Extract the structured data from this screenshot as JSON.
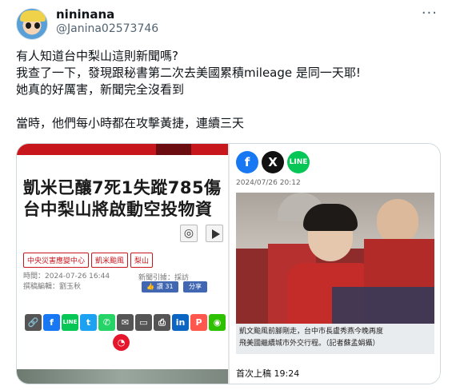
{
  "tweet": {
    "display_name": "nininana",
    "handle": "@Janina02573746",
    "more_icon": "more-horizontal-icon",
    "lines": [
      "有人知道台中梨山這則新聞嗎?",
      "我查了一下，發現跟秘書第二次去美國累積mileage 是同一天耶!",
      "她真的好厲害，新聞完全沒看到",
      "",
      "當時，他們每小時都在攻擊黃捷，連續三天"
    ]
  },
  "left_article": {
    "headline_line1": "凱米已釀7死1失蹤785傷",
    "headline_line2": "台中梨山將啟動空投物資",
    "tags": [
      "中央災害應變中心",
      "凱米颱風",
      "梨山"
    ],
    "time_label": "時間：2024-07-26 16:44",
    "editor_label": "撰稿編輯：劉玉秋",
    "source_label": "新聞引據：採訪",
    "like_label": "👍 讚 31",
    "share_label": "分享",
    "share_icons": [
      "link-icon",
      "facebook-icon",
      "line-icon",
      "twitter-icon",
      "whatsapp-icon",
      "email-icon",
      "sms-icon",
      "print-icon",
      "linkedin-icon",
      "plurk-icon",
      "wechat-icon",
      "weibo-icon"
    ]
  },
  "right_article": {
    "social_icons": [
      "facebook-icon",
      "x-icon",
      "line-icon"
    ],
    "line_text": "LINE",
    "date": "2024/07/26 20:12",
    "caption_line1": "凱文颱風前腳剛走，台中市長盧秀燕今晚再度",
    "caption_line2": "飛美國繼續城市外交行程。（記者蘇孟娟攝）",
    "posted_label": "首次上稿 19:24"
  },
  "colors": {
    "red": "#c8161d",
    "facebook": "#1877f2",
    "line": "#06c755",
    "text": "#0f1419",
    "muted": "#536471"
  }
}
